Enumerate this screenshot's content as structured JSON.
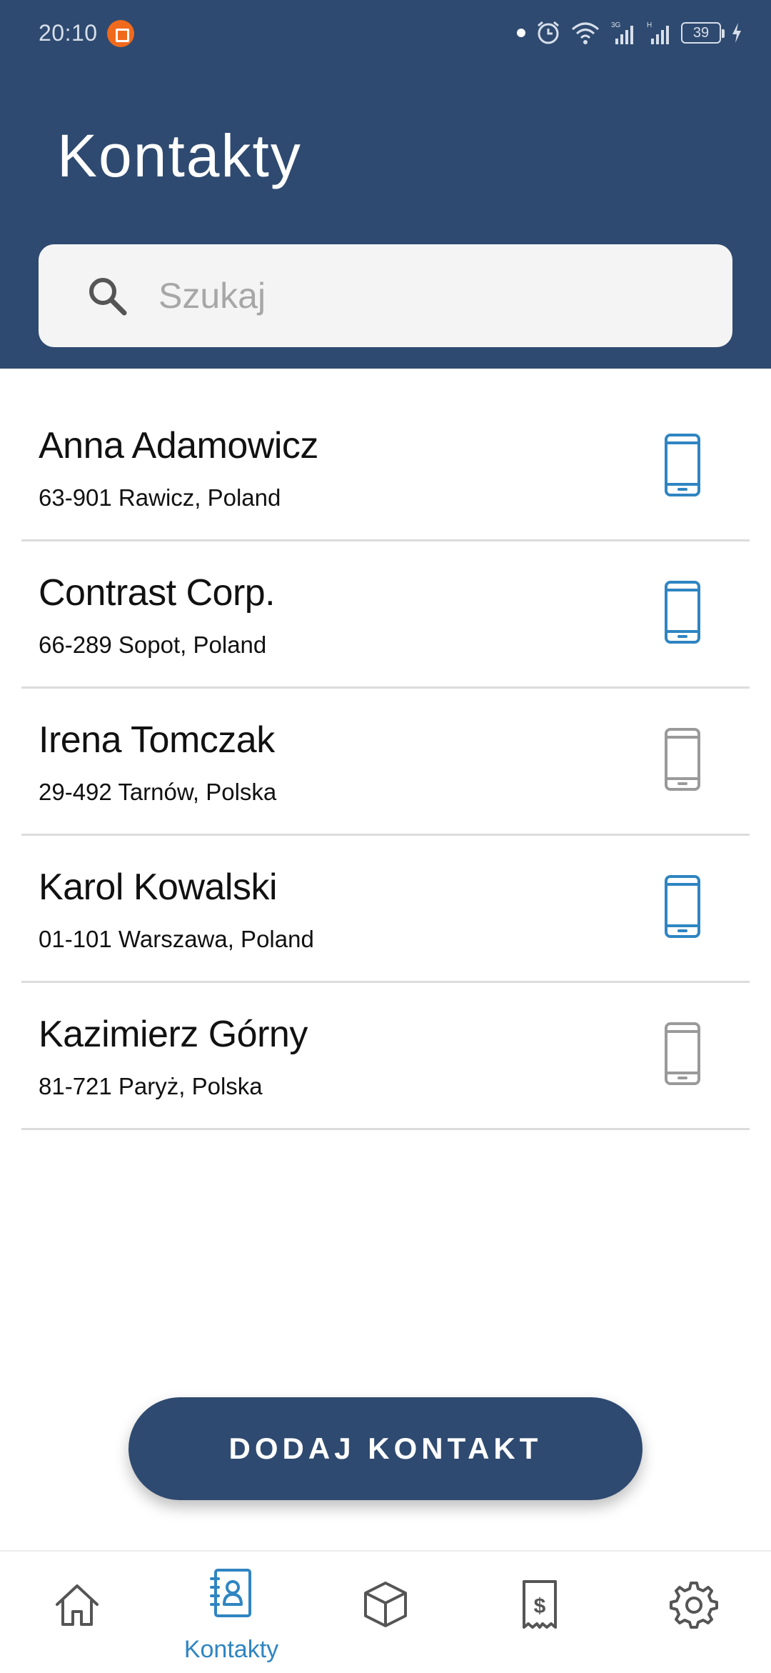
{
  "status_bar": {
    "time": "20:10",
    "battery": "39"
  },
  "header": {
    "title": "Kontakty"
  },
  "search": {
    "placeholder": "Szukaj"
  },
  "contacts": [
    {
      "name": "Anna Adamowicz",
      "address": "63-901 Rawicz, Poland",
      "mobile_color": "#2f85c2"
    },
    {
      "name": "Contrast Corp.",
      "address": "66-289 Sopot, Poland",
      "mobile_color": "#2f85c2"
    },
    {
      "name": "Irena Tomczak",
      "address": "29-492 Tarnów, Polska",
      "mobile_color": "#9a9a9a"
    },
    {
      "name": "Karol Kowalski",
      "address": "01-101 Warszawa, Poland",
      "mobile_color": "#2f85c2"
    },
    {
      "name": "Kazimierz Górny",
      "address": "81-721 Paryż, Polska",
      "mobile_color": "#9a9a9a"
    }
  ],
  "add_button": {
    "label": "DODAJ KONTAKT"
  },
  "bottom_nav": {
    "items": [
      {
        "icon": "home-icon",
        "label": ""
      },
      {
        "icon": "contacts-book-icon",
        "label": "Kontakty",
        "active": true
      },
      {
        "icon": "box-icon",
        "label": ""
      },
      {
        "icon": "receipt-dollar-icon",
        "label": ""
      },
      {
        "icon": "gear-icon",
        "label": ""
      }
    ]
  },
  "colors": {
    "header_bg": "#2f4a70",
    "accent": "#2f85c2",
    "inactive_icon": "#9a9a9a"
  }
}
